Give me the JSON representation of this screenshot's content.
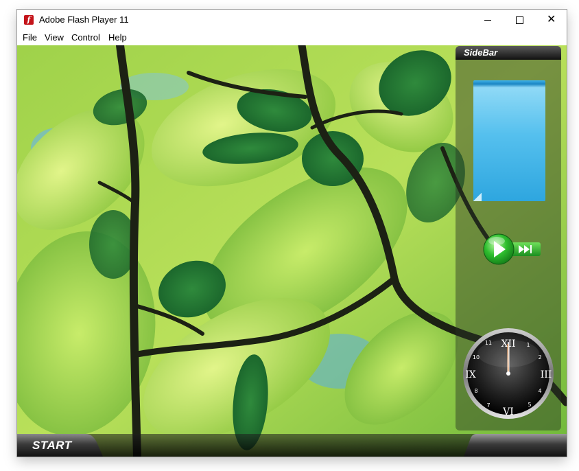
{
  "window": {
    "title": "Adobe Flash Player 11",
    "app_icon_glyph": "f",
    "close_glyph": "✕"
  },
  "menu": [
    "File",
    "View",
    "Control",
    "Help"
  ],
  "sidebar": {
    "title": "SideBar"
  },
  "clock": {
    "roman": [
      "XII",
      "III",
      "VI",
      "IX"
    ],
    "arabic": [
      "1",
      "2",
      "4",
      "5",
      "7",
      "8",
      "10",
      "11"
    ],
    "time": "12:00"
  },
  "taskbar": {
    "start_label": "START"
  },
  "colors": {
    "accent_blue": "#2ea6df",
    "play_green": "#2fbf2f",
    "sidebar_head": "#1c1c1c"
  }
}
